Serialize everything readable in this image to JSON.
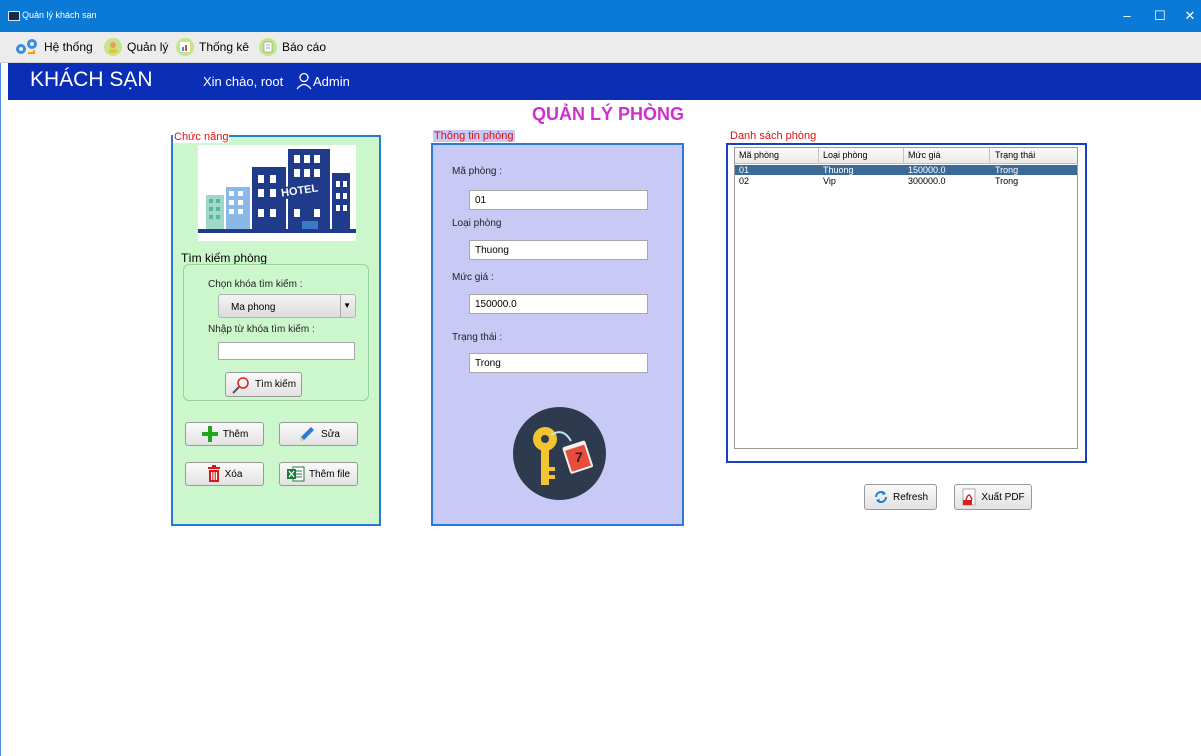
{
  "window": {
    "title": "Quản lý khách sạn"
  },
  "menu": {
    "items": [
      {
        "label": "Hệ thống",
        "icon": "gears-icon"
      },
      {
        "label": "Quản lý",
        "icon": "manager-icon"
      },
      {
        "label": "Thống kê",
        "icon": "chart-icon"
      },
      {
        "label": "Báo cáo",
        "icon": "report-icon"
      }
    ]
  },
  "header": {
    "brand": "KHÁCH SẠN",
    "greeting": "Xin chào, root",
    "role": "Admin"
  },
  "page_title": "QUẢN LÝ PHÒNG",
  "func_panel": {
    "legend": "Chức năng",
    "image_text": "HOTEL",
    "search_title": "Tìm kiếm phòng",
    "key_label": "Chọn khóa tìm kiếm :",
    "key_value": "Ma phong",
    "keyword_label": "Nhập từ khóa tìm kiếm :",
    "keyword_value": "",
    "search_button": "Tìm kiếm",
    "add_button": "Thêm",
    "edit_button": "Sửa",
    "delete_button": "Xóa",
    "add_file_button": "Thêm file"
  },
  "info_panel": {
    "legend": "Thông tin phòng",
    "fields": [
      {
        "label": "Mã phòng :",
        "value": "01"
      },
      {
        "label": "Loại phòng",
        "value": "Thuong"
      },
      {
        "label": "Mức giá :",
        "value": "150000.0"
      },
      {
        "label": "Trạng thái :",
        "value": "Trong"
      }
    ],
    "key_tag_number": "7"
  },
  "list_panel": {
    "legend": "Danh sách phòng",
    "columns": [
      "Mã phòng",
      "Loại phòng",
      "Mức giá",
      "Trạng thái"
    ],
    "rows": [
      [
        "01",
        "Thuong",
        "150000.0",
        "Trong"
      ],
      [
        "02",
        "Vip",
        "300000.0",
        "Trong"
      ]
    ],
    "selected_row": 0,
    "refresh_button": "Refresh",
    "export_button": "Xuất PDF"
  },
  "colors": {
    "title_bar": "#0a7ad6",
    "header": "#0a2fb6",
    "page_title": "#d02fd0",
    "func_bg": "#ccf7cc",
    "info_bg": "#c9c9f6",
    "legend": "#e01010"
  }
}
